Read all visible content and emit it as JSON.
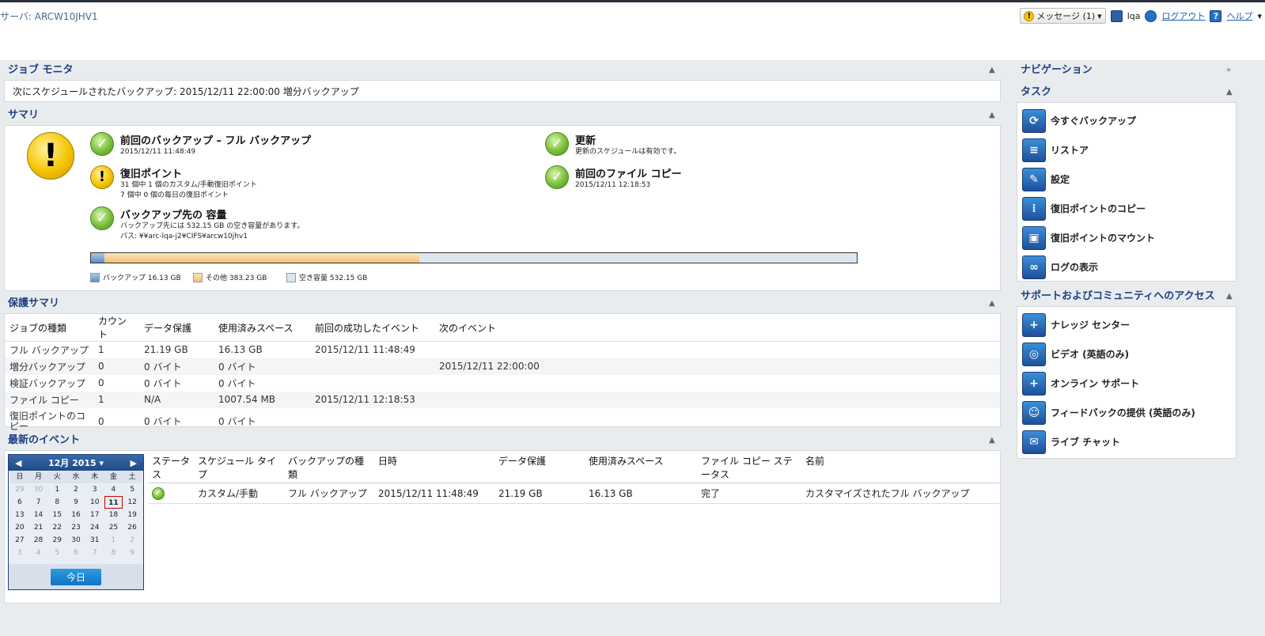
{
  "header": {
    "server": "サーバ: ARCW10JHV1",
    "messages": "メッセージ (1)",
    "user": "lqa",
    "logout": "ログアウト",
    "help": "ヘルプ"
  },
  "job_monitor": {
    "title": "ジョブ モニタ",
    "text": "次にスケジュールされたバックアップ: 2015/12/11 22:00:00 増分バックアップ"
  },
  "summary": {
    "title": "サマリ",
    "items": [
      {
        "title": "前回のバックアップ – フル バックアップ",
        "lines": [
          "2015/12/11 11:48:49"
        ]
      },
      {
        "title": "復旧ポイント",
        "lines": [
          "31 個中 1 個のカスタム/手動復旧ポイント",
          "7 個中 0 個の毎日の復旧ポイント"
        ]
      },
      {
        "title": "バックアップ先の 容量",
        "lines": [
          "バックアップ先には 532.15 GB の空き容量があります。",
          "パス: ¥¥arc-lqa-j2¥CIFS¥arcw10jhv1"
        ]
      },
      {
        "title": "更新",
        "lines": [
          "更新のスケジュールは有効です。"
        ]
      },
      {
        "title": "前回のファイル コピー",
        "lines": [
          "2015/12/11 12:18:53"
        ]
      }
    ],
    "capacity": {
      "backup_gb": 16.13,
      "other_gb": 383.23,
      "free_gb": 532.15
    },
    "legend": [
      "バックアップ 16.13 GB",
      "その他 383.23 GB",
      "空き容量 532.15 GB"
    ]
  },
  "protection": {
    "title": "保護サマリ",
    "headers": [
      "ジョブの種類",
      "カウント",
      "データ保護",
      "使用済みスペース",
      "前回の成功したイベント",
      "次のイベント"
    ],
    "rows": [
      [
        "フル バックアップ",
        "1",
        "21.19 GB",
        "16.13 GB",
        "2015/12/11 11:48:49",
        ""
      ],
      [
        "増分バックアップ",
        "0",
        "0 バイト",
        "0 バイト",
        "",
        "2015/12/11 22:00:00"
      ],
      [
        "検証バックアップ",
        "0",
        "0 バイト",
        "0 バイト",
        "",
        ""
      ],
      [
        "ファイル コピー",
        "1",
        "N/A",
        "1007.54 MB",
        "2015/12/11 12:18:53",
        ""
      ],
      [
        "復旧ポイントのコピー",
        "0",
        "0 バイト",
        "0 バイト",
        "",
        ""
      ]
    ]
  },
  "events": {
    "title": "最新のイベント",
    "calendar": {
      "month": "12月 2015",
      "dow": [
        "日",
        "月",
        "火",
        "水",
        "木",
        "金",
        "土"
      ],
      "days": [
        "29",
        "30",
        "1",
        "2",
        "3",
        "4",
        "5",
        "6",
        "7",
        "8",
        "9",
        "10",
        "11",
        "12",
        "13",
        "14",
        "15",
        "16",
        "17",
        "18",
        "19",
        "20",
        "21",
        "22",
        "23",
        "24",
        "25",
        "26",
        "27",
        "28",
        "29",
        "30",
        "31",
        "1",
        "2",
        "3",
        "4",
        "5",
        "6",
        "7",
        "8",
        "9"
      ],
      "today": "今日"
    },
    "headers": [
      "ステータス",
      "スケジュール タイプ",
      "バックアップの種類",
      "日時",
      "データ保護",
      "使用済みスペース",
      "ファイル コピー ステータス",
      "名前"
    ],
    "rows": [
      [
        "",
        "カスタム/手動",
        "フル バックアップ",
        "2015/12/11 11:48:49",
        "21.19 GB",
        "16.13 GB",
        "完了",
        "カスタマイズされたフル バックアップ"
      ]
    ]
  },
  "nav": {
    "title": "ナビゲーション",
    "tasks_title": "タスク",
    "tasks": [
      "今すぐバックアップ",
      "リストア",
      "設定",
      "復旧ポイントのコピー",
      "復旧ポイントのマウント",
      "ログの表示"
    ],
    "support_title": "サポートおよびコミュニティへのアクセス",
    "support": [
      "ナレッジ センター",
      "ビデオ (英語のみ)",
      "オンライン サポート",
      "フィードバックの提供 (英語のみ)",
      "ライブ チャット"
    ]
  }
}
